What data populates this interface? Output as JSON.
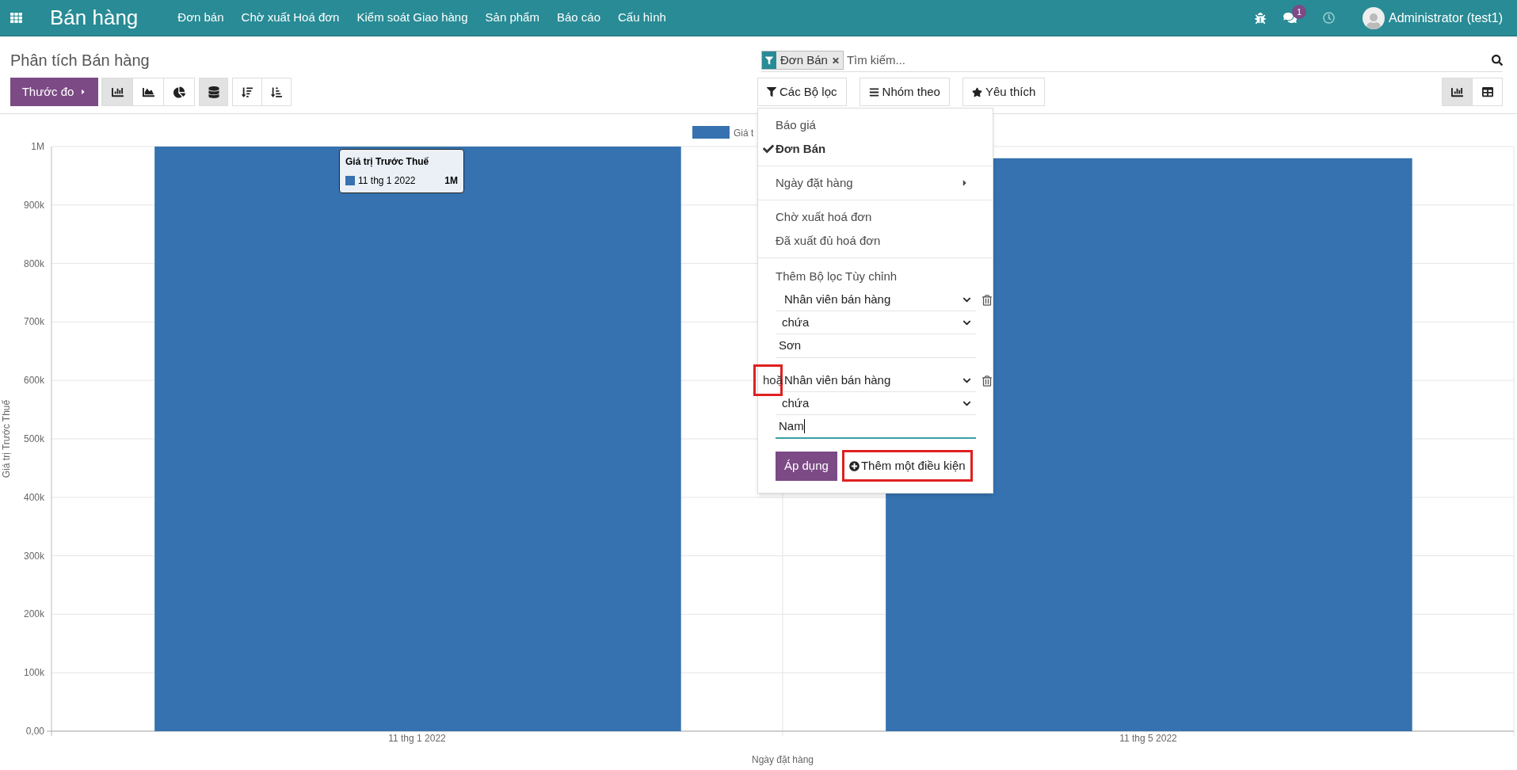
{
  "navbar": {
    "app_title": "Bán hàng",
    "menu": [
      "Đơn bán",
      "Chờ xuất Hoá đơn",
      "Kiểm soát Giao hàng",
      "Sản phẩm",
      "Báo cáo",
      "Cấu hình"
    ],
    "message_count": "1",
    "user": "Administrator (test1)"
  },
  "control_panel": {
    "title": "Phân tích Bán hàng",
    "measure_button": "Thước đo",
    "chart_types": [
      {
        "kind": "bar",
        "selected": true
      },
      {
        "kind": "line",
        "selected": false
      },
      {
        "kind": "pie",
        "selected": false
      }
    ],
    "stacked": true,
    "search": {
      "facets": [
        "Đơn Bán"
      ],
      "placeholder": "Tìm kiếm..."
    },
    "search_buttons": [
      {
        "kind": "filter",
        "label": "Các Bộ lọc"
      },
      {
        "kind": "group",
        "label": "Nhóm theo"
      },
      {
        "kind": "favorite",
        "label": "Yêu thích"
      }
    ],
    "views": [
      {
        "kind": "graph",
        "selected": true
      },
      {
        "kind": "pivot",
        "selected": false
      }
    ]
  },
  "filter_menu": {
    "groups": [
      {
        "items": [
          {
            "label": "Báo giá",
            "checked": false
          },
          {
            "label": "Đơn Bán",
            "checked": true
          }
        ]
      },
      {
        "items": [
          {
            "label": "Ngày đặt hàng",
            "checked": false,
            "submenu": true
          }
        ]
      },
      {
        "items": [
          {
            "label": "Chờ xuất hoá đơn",
            "checked": false
          },
          {
            "label": "Đã xuất đủ hoá đơn",
            "checked": false
          }
        ]
      }
    ],
    "custom_filter": {
      "title": "Thêm Bộ lọc Tùy chỉnh",
      "conditions": [
        {
          "field": "Nhân viên bán hàng",
          "operator": "chứa",
          "value": "Sơn",
          "focused": false
        },
        {
          "connector": "hoặ",
          "connector_highlighted": true,
          "field": "Nhân viên bán hàng",
          "operator": "chứa",
          "value": "Nam",
          "focused": true
        }
      ],
      "apply_button": "Áp dụng",
      "add_condition": {
        "label": "Thêm một điều kiện",
        "highlighted": true
      }
    }
  },
  "chart": {
    "legend": "Giá t",
    "tooltip": {
      "label": "11 thg 1 2022",
      "value": "1M"
    },
    "chart_data": {
      "type": "bar",
      "grid": true,
      "xlabel": "Ngày đặt hàng",
      "ylabel": "Giá trị Trước Thuế",
      "categories": [
        "11 thg 1 2022",
        "11 thg 5 2022"
      ],
      "series": [
        {
          "name": "Giá trị Trước Thuế",
          "color": "#3572af",
          "values": [
            1000000,
            980000
          ]
        }
      ],
      "ylim": [
        0,
        1000000
      ],
      "yticks": [
        {
          "value": 0,
          "label": "0,00"
        },
        {
          "value": 100000,
          "label": "100k"
        },
        {
          "value": 200000,
          "label": "200k"
        },
        {
          "value": 300000,
          "label": "300k"
        },
        {
          "value": 400000,
          "label": "400k"
        },
        {
          "value": 500000,
          "label": "500k"
        },
        {
          "value": 600000,
          "label": "600k"
        },
        {
          "value": 700000,
          "label": "700k"
        },
        {
          "value": 800000,
          "label": "800k"
        },
        {
          "value": 900000,
          "label": "900k"
        },
        {
          "value": 1000000,
          "label": "1M"
        }
      ]
    }
  }
}
